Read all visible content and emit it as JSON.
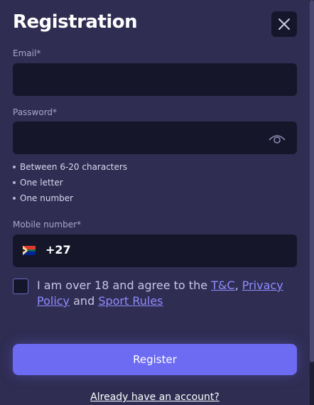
{
  "title": "Registration",
  "email": {
    "label": "Email*",
    "value": "",
    "placeholder": ""
  },
  "password": {
    "label": "Password*",
    "value": "",
    "placeholder": "",
    "rules": [
      "Between 6-20 characters",
      "One letter",
      "One number"
    ]
  },
  "mobile": {
    "label": "Mobile number*",
    "country_code": "+27",
    "value": ""
  },
  "agree": {
    "prefix": "I am over 18 and agree to the ",
    "tc": "T&C",
    "sep": ", ",
    "privacy": "Privacy Policy",
    "and": " and ",
    "sport_rules": "Sport Rules",
    "checked": false
  },
  "register_label": "Register",
  "login_link": "Already have an account?",
  "icons": {
    "close": "close-icon",
    "eye": "eye-icon",
    "flag": "south-africa-flag-icon"
  },
  "colors": {
    "accent": "#6d6bf2",
    "link": "#8f8cff",
    "background": "#2f2d52",
    "input": "#16162a"
  }
}
